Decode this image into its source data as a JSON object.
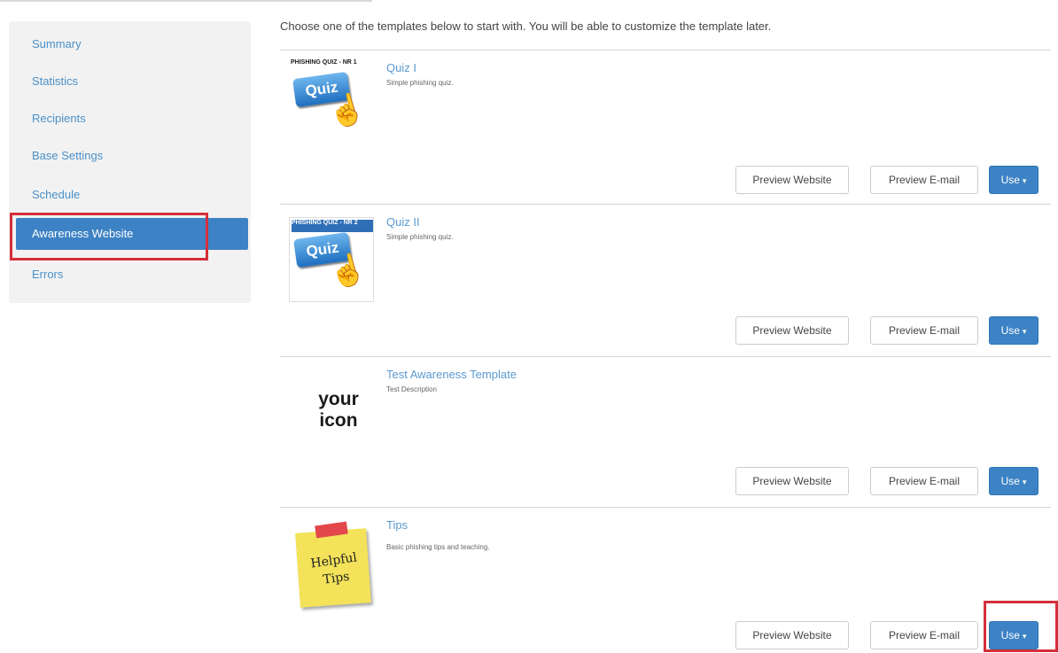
{
  "sidebar": {
    "items": [
      {
        "label": "Summary"
      },
      {
        "label": "Statistics"
      },
      {
        "label": "Recipients"
      },
      {
        "label": "Base Settings"
      },
      {
        "label": "Schedule"
      },
      {
        "label": "Awareness Website"
      },
      {
        "label": "Errors"
      }
    ],
    "active_index": 5
  },
  "main": {
    "intro": "Choose one of the templates below to start with. You will be able to customize the template later.",
    "templates": [
      {
        "title": "Quiz I",
        "description": "Simple phishing quiz.",
        "thumb_banner": "PHISHING QUIZ - NR 1",
        "thumb_label": "Quiz"
      },
      {
        "title": "Quiz II",
        "description": "Simple phishing quiz.",
        "thumb_banner": "PHISHING QUIZ - NR 2",
        "thumb_label": "Quiz"
      },
      {
        "title": "Test Awareness Template",
        "description": "Test Description",
        "thumb_line1": "your",
        "thumb_line2": "icon"
      },
      {
        "title": "Tips",
        "description": "Basic phishing tips and teaching.",
        "thumb_line1": "Helpful",
        "thumb_line2": "Tips"
      }
    ],
    "buttons": {
      "preview_website": "Preview Website",
      "preview_email": "Preview E-mail",
      "use": "Use"
    }
  },
  "colors": {
    "accent": "#3d82c4",
    "highlight": "#d42f3a",
    "link": "#5a9ad0"
  }
}
